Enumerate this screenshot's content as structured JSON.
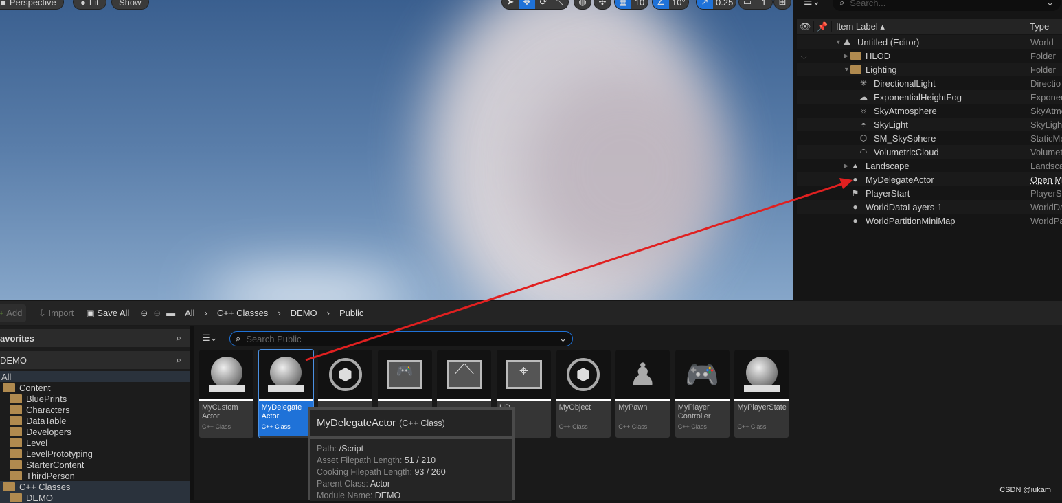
{
  "viewport": {
    "buttons": {
      "perspective": "Perspective",
      "lit": "Lit",
      "show": "Show"
    },
    "grid_snap": "10",
    "rotation_snap": "10°",
    "scale_snap": "0.25",
    "camera_speed": "1"
  },
  "outliner": {
    "search_placeholder": "Search...",
    "columns": {
      "label": "Item Label",
      "type": "Type"
    },
    "rows": [
      {
        "label": "Untitled (Editor)",
        "type": "World",
        "icon": "world-icon",
        "indent": 0
      },
      {
        "label": "HLOD",
        "type": "Folder",
        "icon": "folder-icon",
        "indent": 1
      },
      {
        "label": "Lighting",
        "type": "Folder",
        "icon": "folder-open-icon",
        "indent": 1
      },
      {
        "label": "DirectionalLight",
        "type": "Directio",
        "icon": "directional-light-icon",
        "indent": 2
      },
      {
        "label": "ExponentialHeightFog",
        "type": "Exponer",
        "icon": "fog-icon",
        "indent": 2
      },
      {
        "label": "SkyAtmosphere",
        "type": "SkyAtmo",
        "icon": "sky-atmosphere-icon",
        "indent": 2
      },
      {
        "label": "SkyLight",
        "type": "SkyLigh",
        "icon": "sky-light-icon",
        "indent": 2
      },
      {
        "label": "SM_SkySphere",
        "type": "StaticMe",
        "icon": "static-mesh-icon",
        "indent": 2
      },
      {
        "label": "VolumetricCloud",
        "type": "Volumet",
        "icon": "cloud-icon",
        "indent": 2
      },
      {
        "label": "Landscape",
        "type": "Landsca",
        "icon": "landscape-icon",
        "indent": 1
      },
      {
        "label": "MyDelegateActor",
        "type": "Open M",
        "icon": "actor-icon",
        "indent": 1
      },
      {
        "label": "PlayerStart",
        "type": "PlayerSt",
        "icon": "player-start-icon",
        "indent": 1
      },
      {
        "label": "WorldDataLayers-1",
        "type": "WorldDa",
        "icon": "actor-icon",
        "indent": 1
      },
      {
        "label": "WorldPartitionMiniMap",
        "type": "WorldPa",
        "icon": "actor-icon",
        "indent": 1
      }
    ]
  },
  "content_browser": {
    "toolbar": {
      "add": "Add",
      "import": "Import",
      "save_all": "Save All"
    },
    "breadcrumb": [
      "All",
      "C++ Classes",
      "DEMO",
      "Public"
    ],
    "search_placeholder": "Search Public",
    "favorites": "avorites",
    "project": "DEMO",
    "tree": [
      {
        "label": "All",
        "indent": 0
      },
      {
        "label": "Content",
        "indent": 1
      },
      {
        "label": "BluePrints",
        "indent": 2
      },
      {
        "label": "Characters",
        "indent": 2
      },
      {
        "label": "DataTable",
        "indent": 2
      },
      {
        "label": "Developers",
        "indent": 2
      },
      {
        "label": "Level",
        "indent": 2
      },
      {
        "label": "LevelPrototyping",
        "indent": 2
      },
      {
        "label": "StarterContent",
        "indent": 2
      },
      {
        "label": "ThirdPerson",
        "indent": 2
      },
      {
        "label": "C++ Classes",
        "indent": 1
      },
      {
        "label": "DEMO",
        "indent": 2
      }
    ],
    "tiles": [
      {
        "name": "MyCustom Actor",
        "sub": "C++ Class",
        "icon": "sphere"
      },
      {
        "name": "MyDelegate Actor",
        "sub": "C++ Class",
        "icon": "sphere",
        "selected": true
      },
      {
        "name": "",
        "sub": "",
        "icon": "object"
      },
      {
        "name": "",
        "sub": "",
        "icon": "gamemode"
      },
      {
        "name": "",
        "sub": "",
        "icon": "gamestate"
      },
      {
        "name": "UD",
        "sub": "lass",
        "icon": "hud"
      },
      {
        "name": "MyObject",
        "sub": "C++ Class",
        "icon": "object"
      },
      {
        "name": "MyPawn",
        "sub": "C++ Class",
        "icon": "pawn"
      },
      {
        "name": "MyPlayer Controller",
        "sub": "C++ Class",
        "icon": "gamepad"
      },
      {
        "name": "MyPlayerState",
        "sub": "C++ Class",
        "icon": "sphere"
      }
    ]
  },
  "tooltip": {
    "title": "MyDelegateActor",
    "kind": "(C++ Class)",
    "rows": [
      {
        "k": "Path:",
        "v": "/Script"
      },
      {
        "k": "Asset Filepath Length:",
        "v": "51 / 210"
      },
      {
        "k": "Cooking Filepath Length:",
        "v": "93 / 260"
      },
      {
        "k": "Parent Class:",
        "v": "Actor"
      },
      {
        "k": "Module Name:",
        "v": "DEMO"
      }
    ]
  },
  "watermark": "CSDN @iukam",
  "colors": {
    "accent": "#1f72d8",
    "arrow": "#e02020",
    "folder": "#b08a4f"
  }
}
